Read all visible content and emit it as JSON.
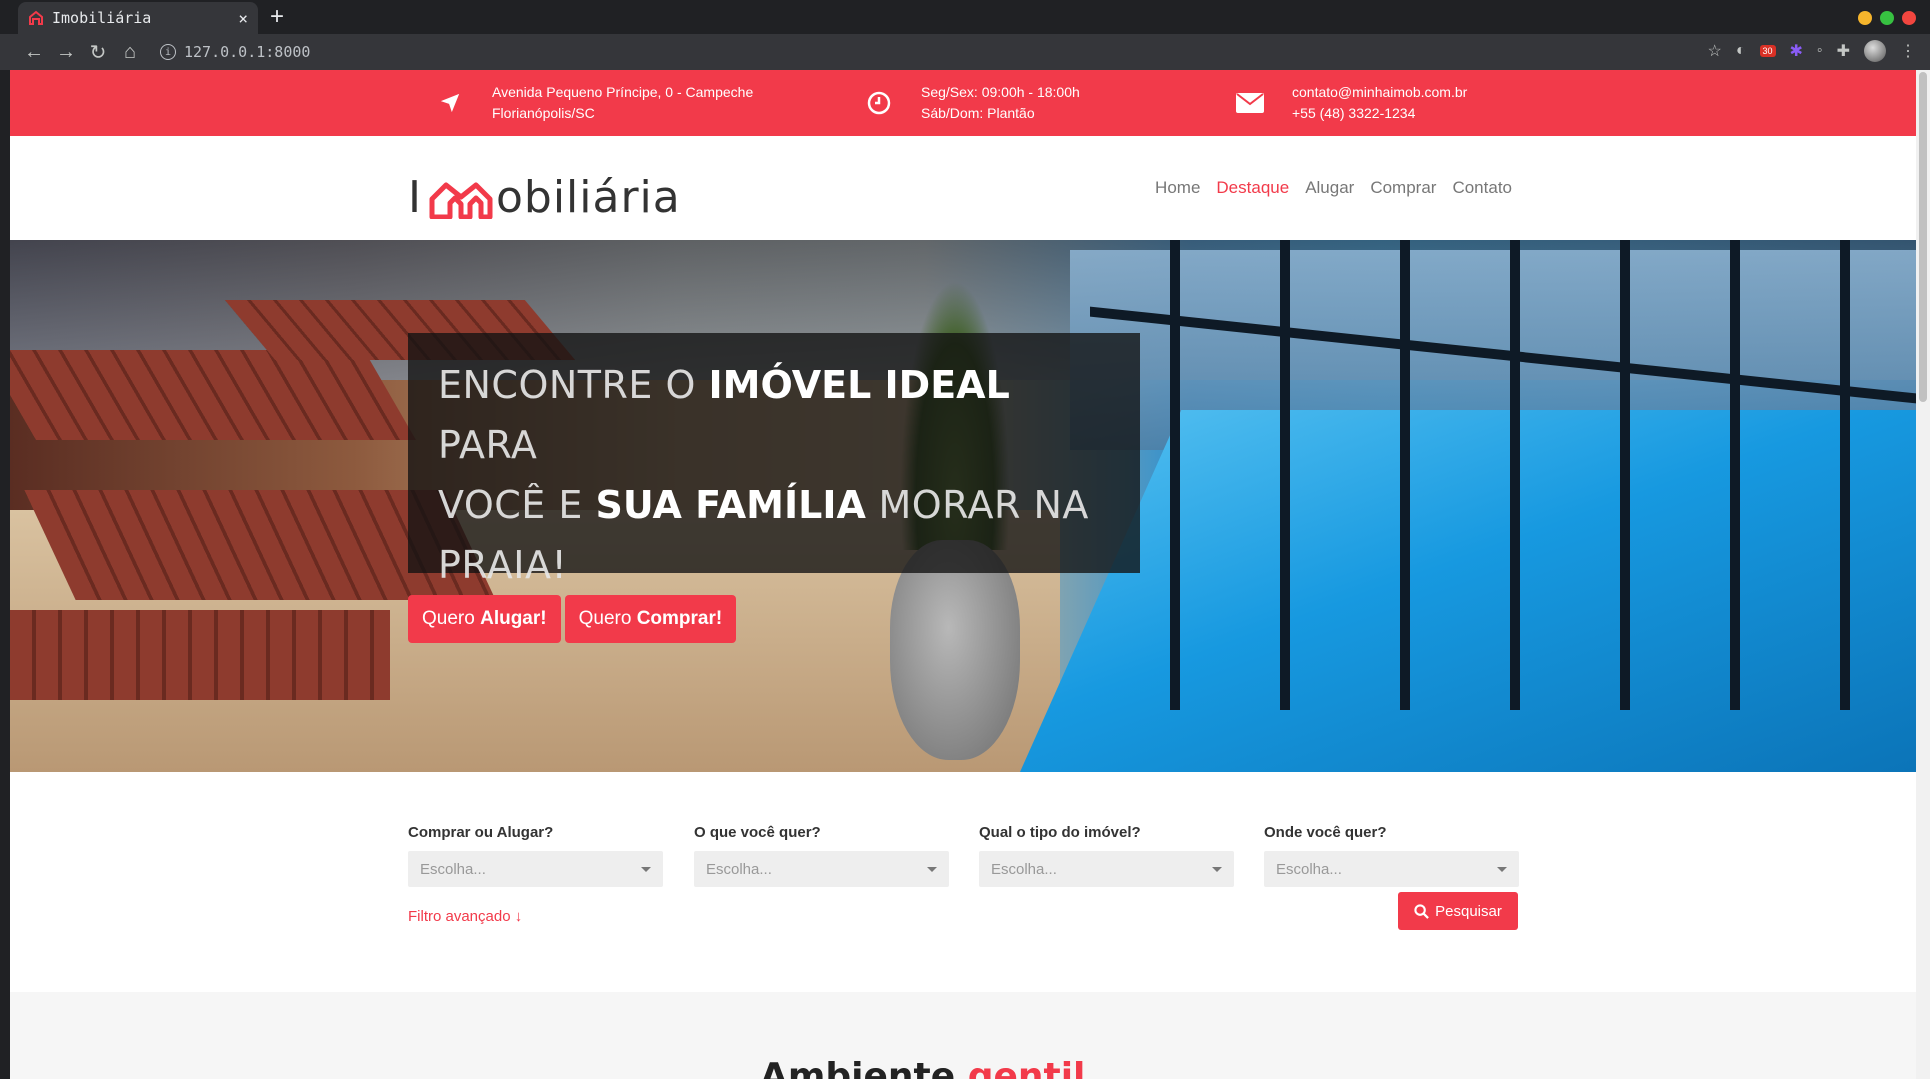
{
  "browser": {
    "tab_title": "Imobiliária",
    "new_tab": "+",
    "close": "×",
    "url": "127.0.0.1:8000",
    "ext_badge": "30"
  },
  "topbar": {
    "address_line1": "Avenida Pequeno Príncipe, 0 - Campeche",
    "address_line2": "Florianópolis/SC",
    "hours_line1": "Seg/Sex: 09:00h - 18:00h",
    "hours_line2": "Sáb/Dom: Plantão",
    "email": "contato@minhaimob.com.br",
    "phone": "+55 (48) 3322-1234",
    "color": "#f23a4a"
  },
  "header": {
    "logo_prefix": "I",
    "logo_suffix": "obiliária",
    "menu": [
      "Home",
      "Destaque",
      "Alugar",
      "Comprar",
      "Contato"
    ],
    "active_menu": "Destaque"
  },
  "hero": {
    "l1_a": "ENCONTRE O ",
    "l1_b": "IMÓVEL IDEAL",
    "l1_c": " PARA",
    "l2_a": "VOCÊ E ",
    "l2_b": "SUA FAMÍLIA",
    "l2_c": " MORAR NA",
    "l3": "PRAIA!",
    "btn_rent_a": "Quero ",
    "btn_rent_b": "Alugar!",
    "btn_buy_a": "Quero ",
    "btn_buy_b": "Comprar!"
  },
  "search": {
    "fields": [
      {
        "label": "Comprar ou Alugar?",
        "placeholder": "Escolha..."
      },
      {
        "label": "O que você quer?",
        "placeholder": "Escolha..."
      },
      {
        "label": "Qual o tipo do imóvel?",
        "placeholder": "Escolha..."
      },
      {
        "label": "Onde você quer?",
        "placeholder": "Escolha..."
      }
    ],
    "advanced": "Filtro avançado ↓",
    "submit": "Pesquisar"
  },
  "next_section": {
    "title_a": "Ambiente ",
    "title_b": "gentil"
  }
}
